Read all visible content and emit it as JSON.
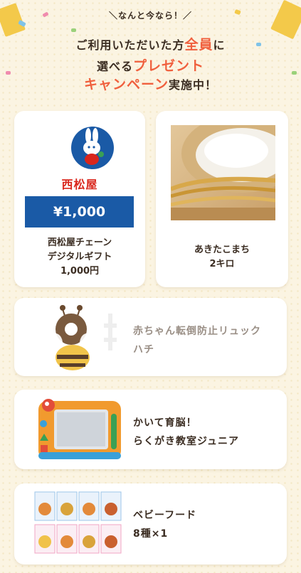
{
  "header": {
    "tag": "＼なんと今なら！／",
    "line1_a": "ご利用いただいた方",
    "line1_accent": "全員",
    "line1_b": "に",
    "line2_a": "選べる",
    "line2_accent": "プレゼント",
    "line3_accent": "キャンペーン",
    "line3_b": "実施中！"
  },
  "items": [
    {
      "brand": "西松屋",
      "price": "¥1,000",
      "lines": [
        "西松屋チェーン",
        "デジタルギフト",
        "1,000円"
      ]
    },
    {
      "lines": [
        "あきたこまち",
        "2キロ"
      ]
    },
    {
      "lines": [
        "赤ちゃん転倒防止リュック",
        "ハチ"
      ],
      "text_color": "#9a8f86"
    },
    {
      "lines": [
        "かいて育脳！",
        "らくがき教室ジュニア"
      ],
      "text_color": "#3b2d22"
    },
    {
      "lines": [
        "ベビーフード",
        "8種×1"
      ],
      "text_color": "#3b2d22"
    }
  ],
  "colors": {
    "accent": "#f0603e",
    "brand_blue": "#1a5aa6",
    "brand_red": "#d9261c",
    "background": "#fbf4e2"
  }
}
